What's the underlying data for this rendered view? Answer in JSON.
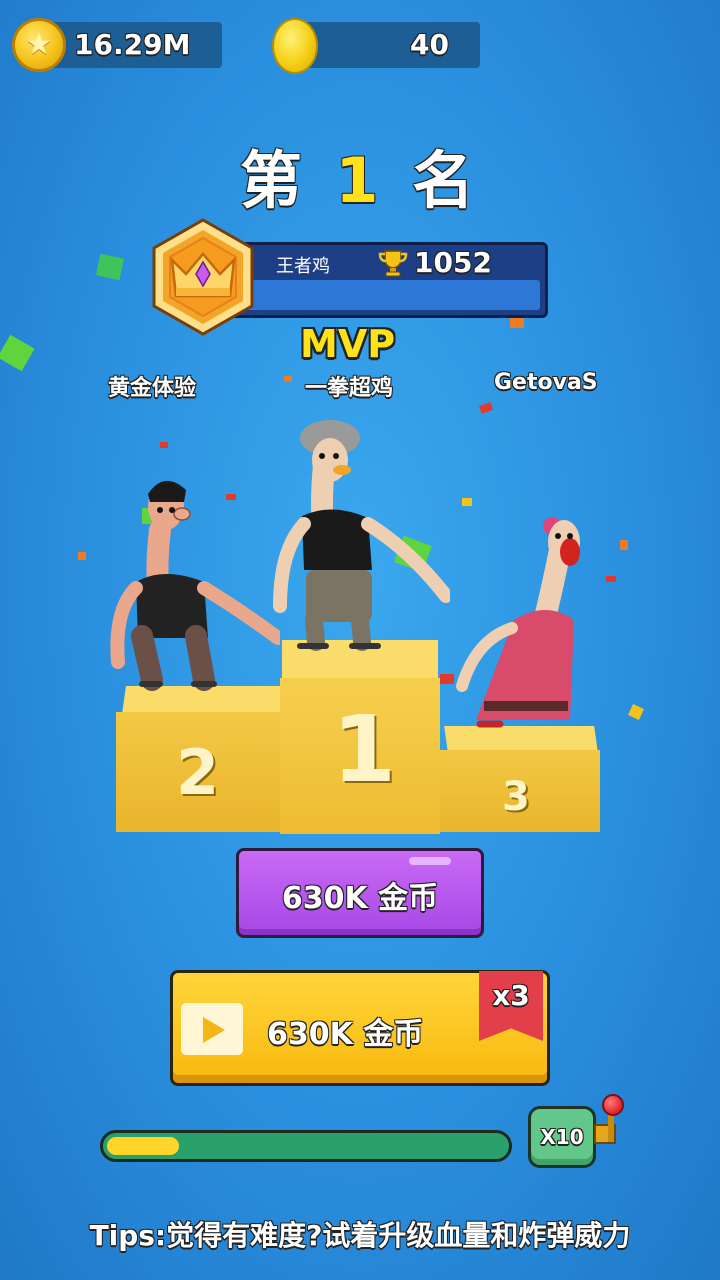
{
  "currency": {
    "coins": "16.29M",
    "gems": "40"
  },
  "rank": {
    "prefix": "第",
    "number": "1",
    "suffix": "名"
  },
  "player_card": {
    "title": "王者鸡",
    "trophies": "1052",
    "progress_fraction": 0.0
  },
  "mvp_label": "MVP",
  "podium": {
    "left_name": "黄金体验",
    "center_name": "一拳超鸡",
    "right_name": "GetovaS",
    "labels": {
      "first": "1",
      "second": "2",
      "third": "3"
    }
  },
  "buttons": {
    "claim": {
      "amount": "630K",
      "unit": "金币"
    },
    "video_claim": {
      "amount": "630K",
      "unit": "金币",
      "multiplier": "x3"
    }
  },
  "spin": {
    "progress_fraction": 0.18,
    "multiplier_label": "X10"
  },
  "tips": "Tips:觉得有难度?试着升级血量和炸弹威力",
  "colors": {
    "background": "#2a8fde",
    "gold": "#ffe21a",
    "purple_button": "#b455ec",
    "yellow_button": "#fbc724",
    "ribbon": "#e23f4b"
  },
  "icons": [
    "star-coin-icon",
    "gem-icon",
    "crown-badge-icon",
    "trophy-icon",
    "video-play-icon",
    "lever-icon"
  ]
}
